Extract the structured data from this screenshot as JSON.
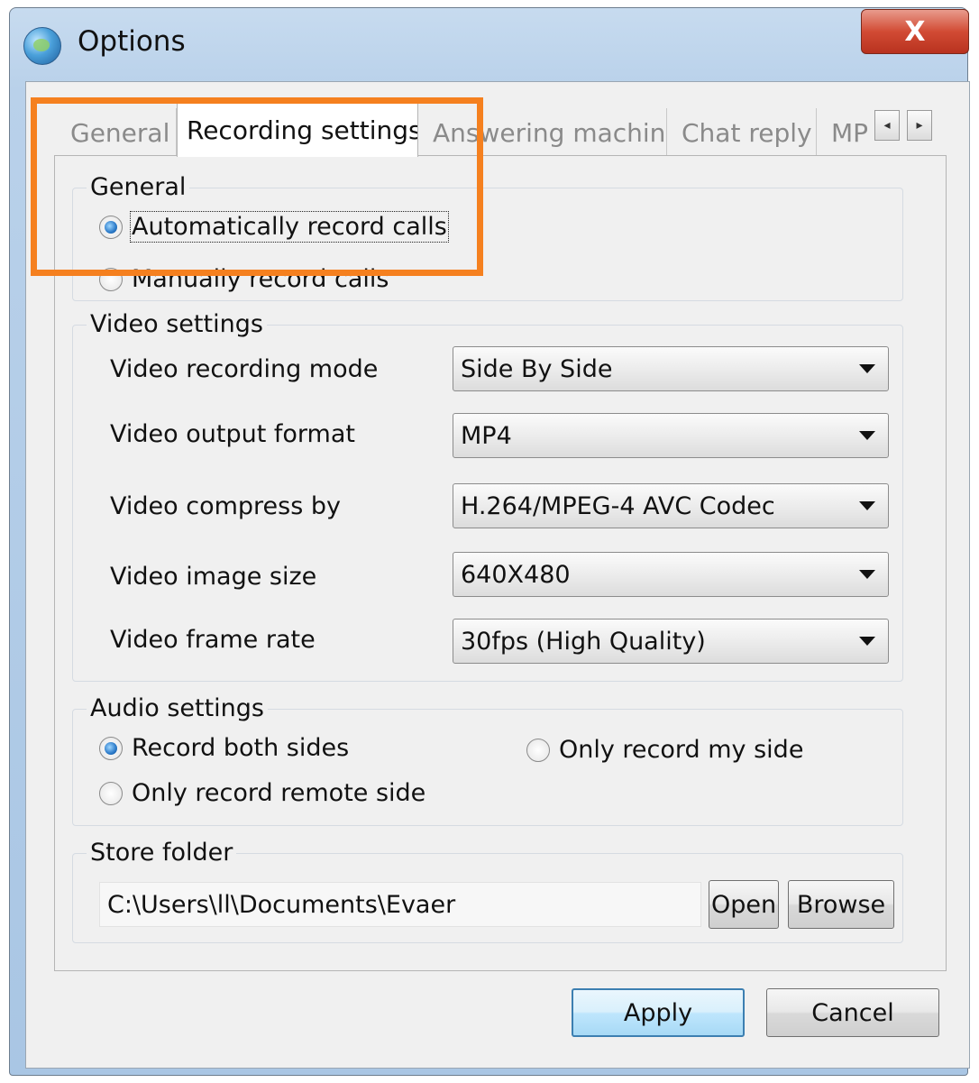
{
  "window": {
    "title": "Options",
    "close_label": "X"
  },
  "tabs": [
    {
      "label": "General",
      "active": false
    },
    {
      "label": "Recording settings",
      "active": true
    },
    {
      "label": "Answering machine",
      "active": false
    },
    {
      "label": "Chat reply",
      "active": false
    },
    {
      "label": "MP",
      "active": false
    }
  ],
  "tab_scroll": {
    "left": "◂",
    "right": "▸"
  },
  "general": {
    "label": "General",
    "options": [
      {
        "label": "Automatically record calls",
        "checked": true
      },
      {
        "label": "Manually record calls",
        "checked": false
      }
    ]
  },
  "video": {
    "label": "Video settings",
    "rows": [
      {
        "label": "Video recording mode",
        "value": "Side By Side"
      },
      {
        "label": "Video output format",
        "value": "MP4"
      },
      {
        "label": "Video compress by",
        "value": "H.264/MPEG-4 AVC Codec"
      },
      {
        "label": "Video image size",
        "value": "640X480"
      },
      {
        "label": "Video frame rate",
        "value": "30fps (High Quality)"
      }
    ]
  },
  "audio": {
    "label": "Audio settings",
    "options": [
      {
        "label": "Record both sides",
        "checked": true
      },
      {
        "label": "Only record my side",
        "checked": false
      },
      {
        "label": "Only record remote side",
        "checked": false
      }
    ]
  },
  "store": {
    "label": "Store folder",
    "path": "C:\\Users\\ll\\Documents\\Evaer",
    "open_label": "Open",
    "browse_label": "Browse"
  },
  "footer": {
    "apply_label": "Apply",
    "cancel_label": "Cancel"
  },
  "colors": {
    "highlight": "#f5801f",
    "close_button": "#d24b34",
    "radio_checked": "#2a79c8"
  }
}
